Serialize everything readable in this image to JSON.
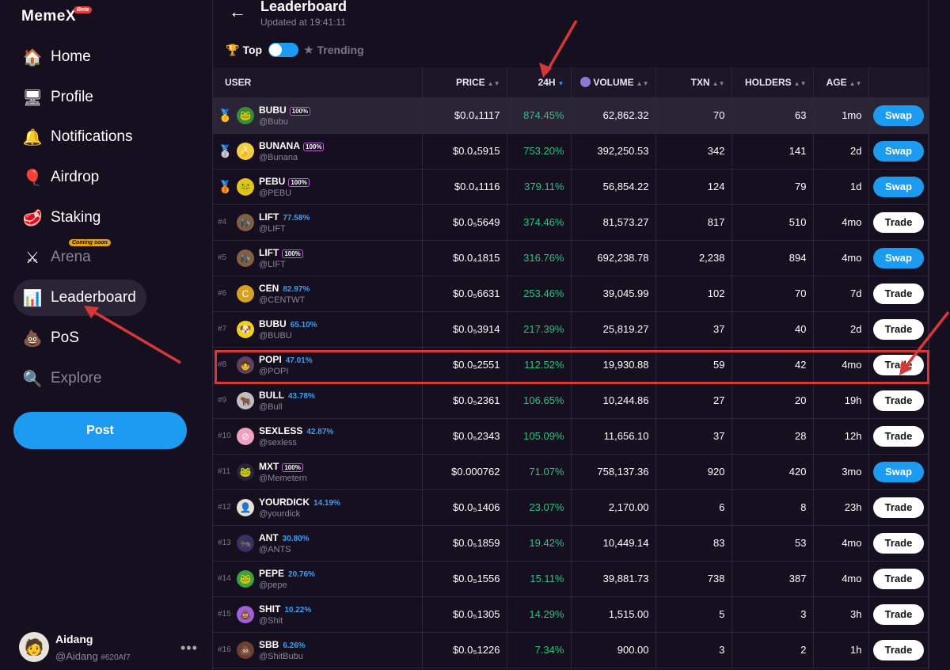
{
  "app": {
    "logo": "MemeX",
    "beta": "Beta"
  },
  "sidebar": {
    "items": [
      {
        "label": "Home",
        "icon": "home-icon",
        "glyph": "🏠"
      },
      {
        "label": "Profile",
        "icon": "profile-icon",
        "glyph": "🖥"
      },
      {
        "label": "Notifications",
        "icon": "bell-icon",
        "glyph": "🔔"
      },
      {
        "label": "Airdrop",
        "icon": "balloon-icon",
        "glyph": "🎈"
      },
      {
        "label": "Staking",
        "icon": "staking-icon",
        "glyph": "🥩"
      },
      {
        "label": "Arena",
        "icon": "swords-icon",
        "glyph": "⚔",
        "badge": "Coming soon"
      },
      {
        "label": "Leaderboard",
        "icon": "podium-icon",
        "glyph": "📊"
      },
      {
        "label": "PoS",
        "icon": "pos-icon",
        "glyph": "💩"
      },
      {
        "label": "Explore",
        "icon": "search-icon",
        "glyph": "🔍"
      }
    ],
    "post_label": "Post",
    "profile": {
      "name": "Aidang",
      "handle": "@Aidang",
      "id": "#620Af7"
    }
  },
  "header": {
    "title": "Leaderboard",
    "updated": "Updated at 19:41:11",
    "toggle_top": "Top",
    "toggle_trending": "Trending"
  },
  "table": {
    "columns": [
      "USER",
      "PRICE",
      "24H",
      "VOLUME",
      "TXN",
      "HOLDERS",
      "AGE"
    ],
    "rows": [
      {
        "rank": "",
        "medal": "🥇",
        "name": "BUBU",
        "handle": "@Bubu",
        "tag": "100%",
        "price": "$0.0₄1117",
        "change": "874.45%",
        "volume": "62,862.32",
        "txn": "70",
        "holders": "63",
        "age": "1mo",
        "action": "Swap",
        "av": "🐸",
        "avbg": "#3a8a3a"
      },
      {
        "rank": "",
        "medal": "🥈",
        "name": "BUNANA",
        "handle": "@Bunana",
        "tag": "100%",
        "price": "$0.0₄5915",
        "change": "753.20%",
        "volume": "392,250.53",
        "txn": "342",
        "holders": "141",
        "age": "2d",
        "action": "Swap",
        "av": "🍌",
        "avbg": "#f0d040"
      },
      {
        "rank": "",
        "medal": "🥉",
        "name": "PEBU",
        "handle": "@PEBU",
        "tag": "100%",
        "price": "$0.0₄1116",
        "change": "379.11%",
        "volume": "56,854.22",
        "txn": "124",
        "holders": "79",
        "age": "1d",
        "action": "Swap",
        "av": "🐸",
        "avbg": "#e8c020"
      },
      {
        "rank": "#4",
        "medal": "",
        "name": "LIFT",
        "handle": "@LIFT",
        "tag": "77.58%",
        "price": "$0.0₅5649",
        "change": "374.46%",
        "volume": "81,573.27",
        "txn": "817",
        "holders": "510",
        "age": "4mo",
        "action": "Trade",
        "av": "🦍",
        "avbg": "#806040"
      },
      {
        "rank": "#5",
        "medal": "",
        "name": "LIFT",
        "handle": "@LIFT",
        "tag": "100%",
        "price": "$0.0₄1815",
        "change": "316.76%",
        "volume": "692,238.78",
        "txn": "2,238",
        "holders": "894",
        "age": "4mo",
        "action": "Swap",
        "av": "🦍",
        "avbg": "#806040"
      },
      {
        "rank": "#6",
        "medal": "",
        "name": "CEN",
        "handle": "@CENTWT",
        "tag": "82.97%",
        "price": "$0.0₅6631",
        "change": "253.46%",
        "volume": "39,045.99",
        "txn": "102",
        "holders": "70",
        "age": "7d",
        "action": "Trade",
        "av": "C",
        "avbg": "#d8a020"
      },
      {
        "rank": "#7",
        "medal": "",
        "name": "BUBU",
        "handle": "@BUBU",
        "tag": "65.10%",
        "price": "$0.0₅3914",
        "change": "217.39%",
        "volume": "25,819.27",
        "txn": "37",
        "holders": "40",
        "age": "2d",
        "action": "Trade",
        "av": "🐶",
        "avbg": "#f0d020"
      },
      {
        "rank": "#8",
        "medal": "",
        "name": "POPI",
        "handle": "@POPI",
        "tag": "47.01%",
        "price": "$0.0₅2551",
        "change": "112.52%",
        "volume": "19,930.88",
        "txn": "59",
        "holders": "42",
        "age": "4mo",
        "action": "Trade",
        "av": "👧",
        "avbg": "#604060"
      },
      {
        "rank": "#9",
        "medal": "",
        "name": "BULL",
        "handle": "@Bull",
        "tag": "43.78%",
        "price": "$0.0₅2361",
        "change": "106.65%",
        "volume": "10,244.86",
        "txn": "27",
        "holders": "20",
        "age": "19h",
        "action": "Trade",
        "av": "🐂",
        "avbg": "#c0c0c0"
      },
      {
        "rank": "#10",
        "medal": "",
        "name": "SEXLESS",
        "handle": "@sexless",
        "tag": "42.87%",
        "price": "$0.0₅2343",
        "change": "105.09%",
        "volume": "11,656.10",
        "txn": "37",
        "holders": "28",
        "age": "12h",
        "action": "Trade",
        "av": "⊘",
        "avbg": "#f0a0c0"
      },
      {
        "rank": "#11",
        "medal": "",
        "name": "MXT",
        "handle": "@Memetern",
        "tag": "100%",
        "price": "$0.000762",
        "change": "71.07%",
        "volume": "758,137.36",
        "txn": "920",
        "holders": "420",
        "age": "3mo",
        "action": "Swap",
        "av": "🐸",
        "avbg": "#2a2436"
      },
      {
        "rank": "#12",
        "medal": "",
        "name": "YOURDICK",
        "handle": "@yourdick",
        "tag": "14.19%",
        "price": "$0.0₅1406",
        "change": "23.07%",
        "volume": "2,170.00",
        "txn": "6",
        "holders": "8",
        "age": "23h",
        "action": "Trade",
        "av": "👤",
        "avbg": "#e8e0d0"
      },
      {
        "rank": "#13",
        "medal": "",
        "name": "ANT",
        "handle": "@ANTS",
        "tag": "30.80%",
        "price": "$0.0₅1859",
        "change": "19.42%",
        "volume": "10,449.14",
        "txn": "83",
        "holders": "53",
        "age": "4mo",
        "action": "Trade",
        "av": "🐜",
        "avbg": "#3a3060"
      },
      {
        "rank": "#14",
        "medal": "",
        "name": "PEPE",
        "handle": "@pepe",
        "tag": "20.76%",
        "price": "$0.0₅1556",
        "change": "15.11%",
        "volume": "39,881.73",
        "txn": "738",
        "holders": "387",
        "age": "4mo",
        "action": "Trade",
        "av": "🐸",
        "avbg": "#40a040"
      },
      {
        "rank": "#15",
        "medal": "",
        "name": "SHIT",
        "handle": "@Shit",
        "tag": "10.22%",
        "price": "$0.0₅1305",
        "change": "14.29%",
        "volume": "1,515.00",
        "txn": "5",
        "holders": "3",
        "age": "3h",
        "action": "Trade",
        "av": "💩",
        "avbg": "#a060e0"
      },
      {
        "rank": "#16",
        "medal": "",
        "name": "SBB",
        "handle": "@ShitBubu",
        "tag": "6.26%",
        "price": "$0.0₅1226",
        "change": "7.34%",
        "volume": "900.00",
        "txn": "3",
        "holders": "2",
        "age": "1h",
        "action": "Trade",
        "av": "💩",
        "avbg": "#6a4030"
      }
    ]
  }
}
